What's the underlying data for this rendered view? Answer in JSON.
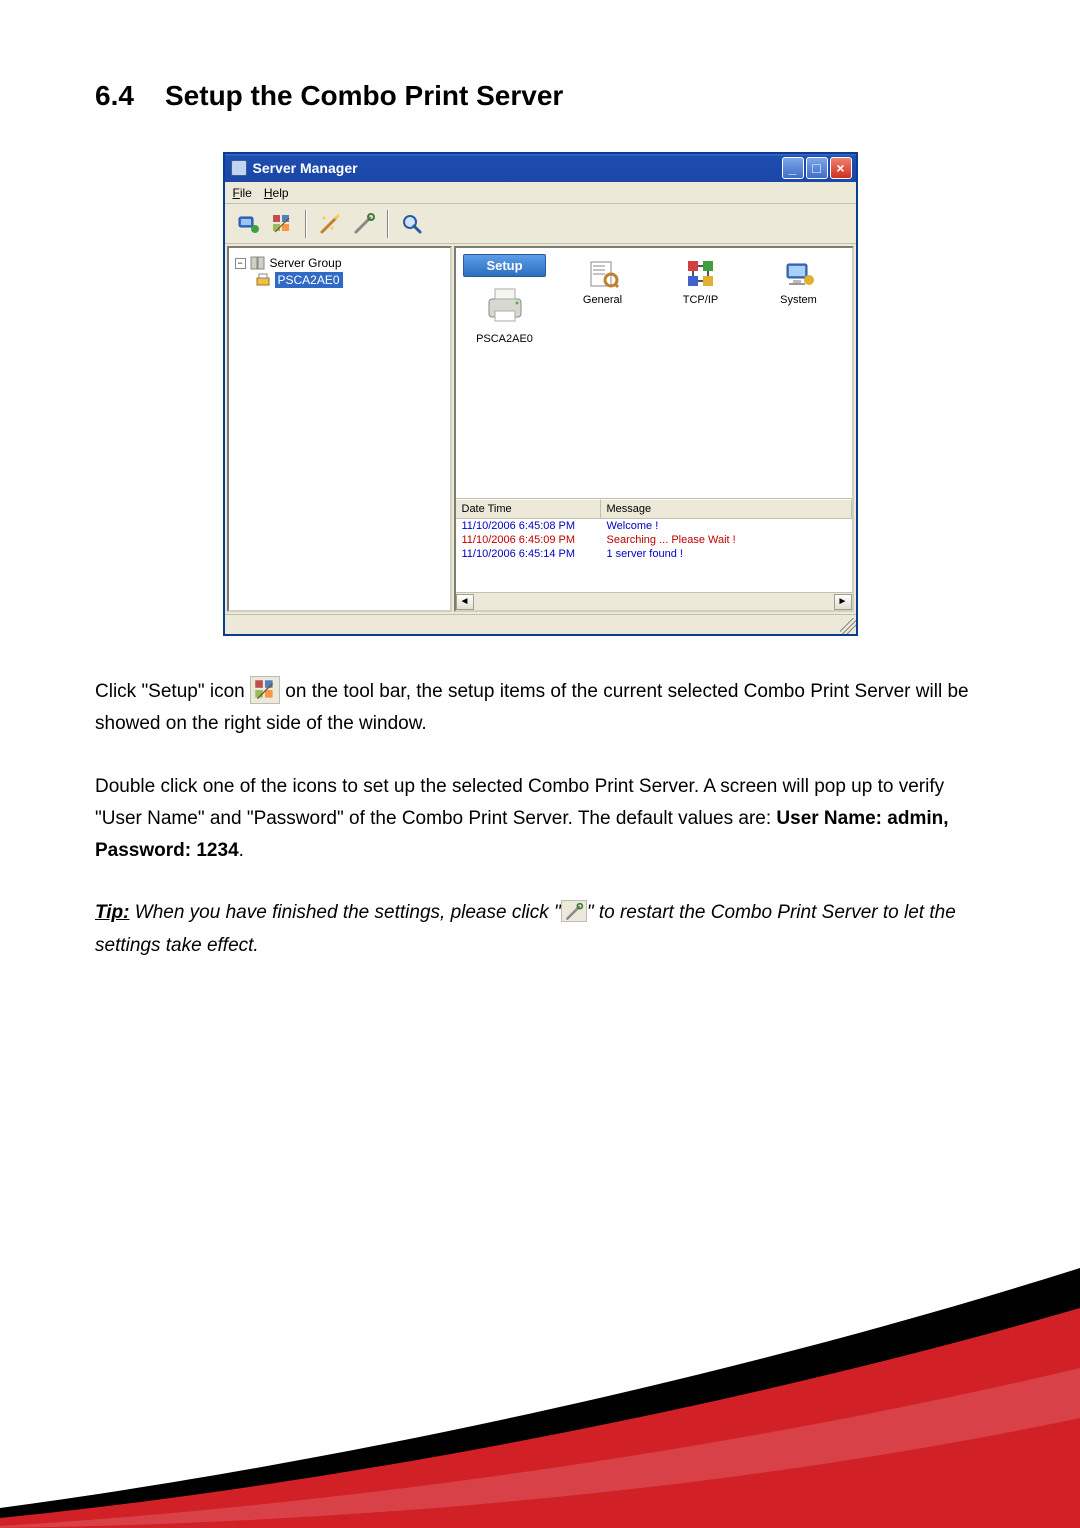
{
  "heading": {
    "number": "6.4",
    "title": "Setup the Combo Print Server"
  },
  "window": {
    "title": "Server Manager",
    "menu": {
      "file": "File",
      "help": "Help",
      "file_ul": "F",
      "help_ul": "H"
    },
    "tree": {
      "root": "Server Group",
      "child": "PSCA2AE0"
    },
    "setup_label": "Setup",
    "items": {
      "printer": "PSCA2AE0",
      "general": "General",
      "tcpip": "TCP/IP",
      "system": "System"
    },
    "log": {
      "col_dt": "Date Time",
      "col_msg": "Message",
      "rows": [
        {
          "dt": "11/10/2006 6:45:08 PM",
          "msg": "Welcome !",
          "class": "blue"
        },
        {
          "dt": "11/10/2006 6:45:09 PM",
          "msg": "Searching ... Please Wait !",
          "class": "red"
        },
        {
          "dt": "11/10/2006 6:45:14 PM",
          "msg": "1 server found !",
          "class": "blue"
        }
      ]
    }
  },
  "paragraphs": {
    "p1a": "Click \"Setup\" icon ",
    "p1b": " on the tool bar, the setup items of the current selected Combo Print Server will be showed on the right side of the window.",
    "p2a": "Double click one of the icons to set up the selected Combo Print Server. A screen will pop up to verify \"User Name\" and \"Password\" of the Combo Print Server. The default values are: ",
    "p2b": "User Name: admin, Password: 1234",
    "p2c": ".",
    "tip_label": "Tip:",
    "tip_a": " When you have finished the settings, please click \"",
    "tip_b": "\" to restart the Combo Print Server to let the settings take effect."
  }
}
